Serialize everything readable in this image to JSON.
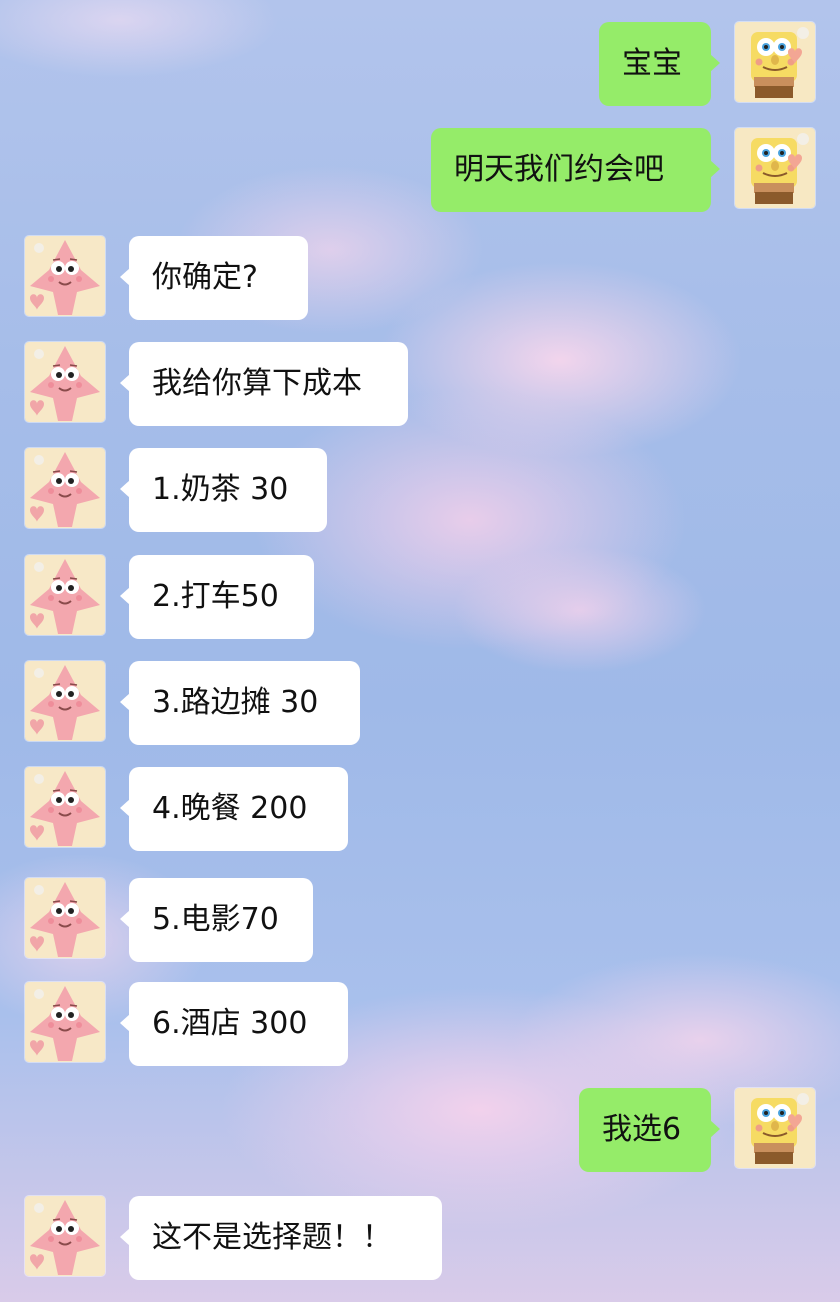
{
  "chat": {
    "messages": [
      {
        "sender": "me",
        "text": "宝宝"
      },
      {
        "sender": "me",
        "text": "明天我们约会吧"
      },
      {
        "sender": "friend",
        "text": "你确定?"
      },
      {
        "sender": "friend",
        "text": "我给你算下成本"
      },
      {
        "sender": "friend",
        "text": "1.奶茶 30"
      },
      {
        "sender": "friend",
        "text": "2.打车50"
      },
      {
        "sender": "friend",
        "text": "3.路边摊 30"
      },
      {
        "sender": "friend",
        "text": "4.晚餐 200"
      },
      {
        "sender": "friend",
        "text": "5.电影70"
      },
      {
        "sender": "friend",
        "text": "6.酒店 300"
      },
      {
        "sender": "me",
        "text": "我选6"
      },
      {
        "sender": "friend",
        "text": "这不是选择题！！"
      }
    ]
  },
  "avatars": {
    "me": "spongebob-avatar-icon",
    "friend": "patrick-avatar-icon"
  },
  "colors": {
    "sent_bubble": "#95ec69",
    "received_bubble": "#ffffff",
    "sky_background": "#a6bde9",
    "cloud_pink": "#f4d2e9"
  }
}
